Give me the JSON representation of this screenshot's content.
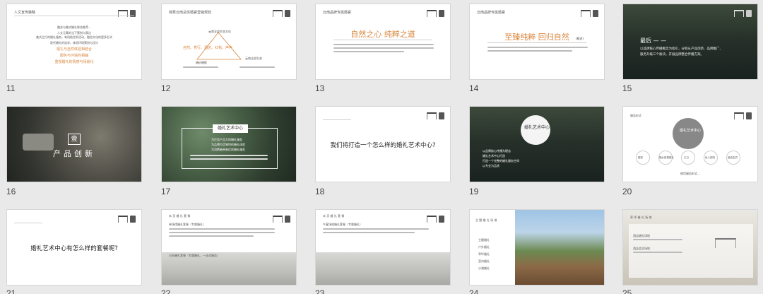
{
  "slides": [
    {
      "num": "11",
      "title": "人文宣传策略",
      "lines": [
        "融合与美式婚礼联合推荐…",
        "人文元素的当下策划与表达",
        "美式主打的婚礼服务，有机结合到活动，融合文化的更多形式",
        "现代婚礼的追求，体验环境策划与设计",
        "婚礼与自然体验相结合",
        "服务与环境的相辅",
        "重视婚礼的情感与场景化"
      ]
    },
    {
      "num": "12",
      "title": "锦秀云南总体婚宴营销规划",
      "center": "云南全部生态文化",
      "bottom_left": "婚纱摄影",
      "bottom_right": "云南全部生态",
      "keywords": "自然、秀行、酒店、红毯、声声"
    },
    {
      "num": "13",
      "title": "云南品牌专属婚宴",
      "headline": "自然之心  纯粹之道"
    },
    {
      "num": "14",
      "title": "云南品牌专属婚宴",
      "headline": "至臻纯粹  回归自然",
      "badge": "(概述)"
    },
    {
      "num": "15",
      "headline": "最后 — —",
      "body": [
        "以品牌核心传播概念为指引，分别从产品创新、品牌推广、",
        "服务升级三个板块，开展品牌整合传播方案。"
      ]
    },
    {
      "num": "16",
      "badge": "壹",
      "headline": "产品创新"
    },
    {
      "num": "17",
      "headline": "婚礼艺术中心",
      "body": [
        "为打造产品力的婚礼服务",
        "为品牌打造独特的婚礼体验",
        "为消费者带来优质婚礼服务"
      ]
    },
    {
      "num": "18",
      "headline": "我们将打造一个怎么样的婚礼艺术中心?"
    },
    {
      "num": "19",
      "headline": "婚礼艺术中心",
      "body": [
        "以品牌核心传播为理念",
        "婚礼艺术中心打造",
        "打造一个完整的婚礼服务空间",
        "以专业为品质"
      ]
    },
    {
      "num": "20",
      "title": "服务形式",
      "center": "婚礼艺术中心",
      "nodes": [
        "婚宴",
        "婚纱影楼婚礼",
        "主日",
        "私人影院",
        "酒店会员"
      ],
      "caption": "使用服务形式…"
    },
    {
      "num": "21",
      "headline": "婚礼艺术中心有怎么样的套餐呢?"
    },
    {
      "num": "22",
      "title": "本 页   婚 礼 套 餐",
      "sections": [
        "单场馆婚礼套餐（专属婚礼）",
        "日间婚礼套餐（专属婚礼，一站式服务）"
      ]
    },
    {
      "num": "23",
      "title": "本 页   婚 礼 套 餐",
      "sections": [
        "午宴场地婚礼套餐（专属婚礼）"
      ]
    },
    {
      "num": "24",
      "title": "主 题 婚 礼 场 地",
      "list": [
        "主题婚礼",
        "户外婚礼",
        "草坪婚礼",
        "室内婚礼",
        "沙滩婚礼"
      ]
    },
    {
      "num": "25",
      "title": "草 坪 婚 礼 场 地",
      "sections": [
        "酒店婚礼场地",
        "酒店会员场地"
      ]
    }
  ],
  "accent": "#d8863e",
  "frame_border": "#d6d6d6"
}
